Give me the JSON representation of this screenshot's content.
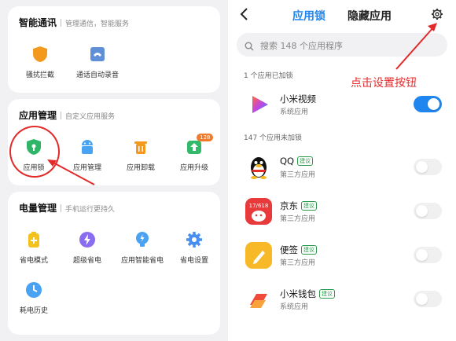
{
  "left": {
    "card1": {
      "title": "智能通讯",
      "subtitle": "管理通信，智能服务",
      "items": [
        {
          "label": "骚扰拦截",
          "icon": "shield-icon",
          "color": "#f39a1e"
        },
        {
          "label": "通话自动录音",
          "icon": "phone-recorder-icon",
          "color": "#5f8fd6"
        }
      ]
    },
    "card2": {
      "title": "应用管理",
      "subtitle": "自定义应用服务",
      "items": [
        {
          "label": "应用锁",
          "icon": "app-lock-icon",
          "color": "#2fb567"
        },
        {
          "label": "应用管理",
          "icon": "android-icon",
          "color": "#4aa3f2"
        },
        {
          "label": "应用卸载",
          "icon": "trash-icon",
          "color": "#f39a1e"
        },
        {
          "label": "应用升级",
          "icon": "upgrade-icon",
          "color": "#34b86a",
          "badge": "128"
        }
      ]
    },
    "card3": {
      "title": "电量管理",
      "subtitle": "手机运行更持久",
      "items": [
        {
          "label": "省电模式",
          "icon": "battery-icon",
          "color": "#f3c21e"
        },
        {
          "label": "超级省电",
          "icon": "lightning-icon",
          "color": "#8a6cf0"
        },
        {
          "label": "应用智能省电",
          "icon": "lightbulb-icon",
          "color": "#4aa3f2"
        },
        {
          "label": "省电设置",
          "icon": "gear-icon",
          "color": "#4a8ef0"
        },
        {
          "label": "耗电历史",
          "icon": "clock-icon",
          "color": "#4aa3f2"
        }
      ]
    }
  },
  "right": {
    "tabs": [
      "应用锁",
      "隐藏应用"
    ],
    "search_placeholder": "搜索 148 个应用程序",
    "locked_header": "1 个应用已加锁",
    "unlocked_header": "147 个应用未加锁",
    "annotation": "点击设置按钮",
    "suggest_tag": "建议",
    "locked_apps": [
      {
        "name": "小米视频",
        "type": "系统应用",
        "enabled": true
      }
    ],
    "unlocked_apps": [
      {
        "name": "QQ",
        "type": "第三方应用",
        "suggested": true,
        "enabled": false
      },
      {
        "name": "京东",
        "type": "第三方应用",
        "suggested": true,
        "enabled": false
      },
      {
        "name": "便签",
        "type": "第三方应用",
        "suggested": true,
        "enabled": false
      },
      {
        "name": "小米钱包",
        "type": "系统应用",
        "suggested": true,
        "enabled": false
      }
    ],
    "jd_icon_text": "17/618",
    "accent": "#1f86f0",
    "annotation_color": "#e32a2a"
  }
}
